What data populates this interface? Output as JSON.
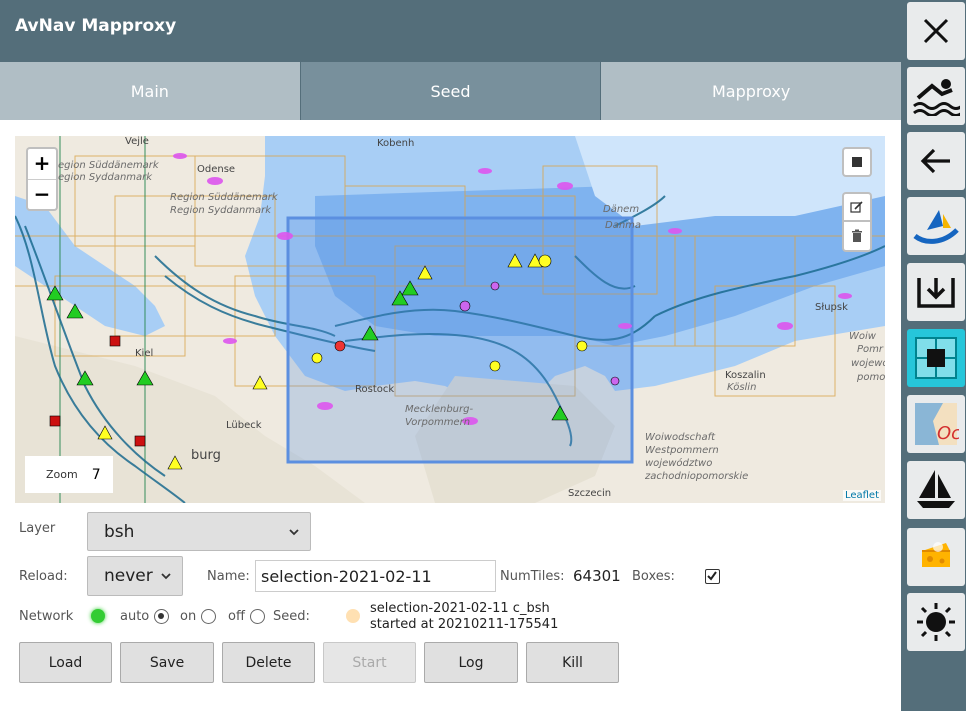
{
  "app": {
    "title": "AvNav Mapproxy"
  },
  "tabs": [
    {
      "label": "Main",
      "active": false
    },
    {
      "label": "Seed",
      "active": true
    },
    {
      "label": "Mapproxy",
      "active": false
    }
  ],
  "sidebar": {
    "buttons": [
      {
        "name": "close-icon",
        "active": false
      },
      {
        "name": "man-overboard-icon",
        "active": false
      },
      {
        "name": "back-arrow-icon",
        "active": false
      },
      {
        "name": "avnav-logo-icon",
        "active": false
      },
      {
        "name": "download-icon",
        "active": false
      },
      {
        "name": "mapproxy-icon",
        "active": true
      },
      {
        "name": "ocharts-icon",
        "active": false
      },
      {
        "name": "sailboat-icon",
        "active": false
      },
      {
        "name": "cheese-icon",
        "active": false
      },
      {
        "name": "brightness-icon",
        "active": false
      }
    ]
  },
  "map": {
    "zoom_in": "+",
    "zoom_out": "−",
    "zoom_label": "Zoom",
    "zoom_value": "7",
    "attribution": "Leaflet",
    "labels": {
      "koben": "Kobenh",
      "odense": "Odense",
      "sudd1": "Region Süddänemark",
      "sudd2": "Region Syddanmark",
      "sudd3": "Region Süddänemark",
      "sudd4": "Region Syddanmark",
      "vejle": "Vejle",
      "danem": "Dänem",
      "danma": "Danma",
      "rostock": "Rostock",
      "meck1": "Mecklenburg-",
      "meck2": "Vorpommern",
      "lubeck": "Lübeck",
      "hamburg": "burg",
      "kiel": "Kiel",
      "koszalin1": "Koszalin",
      "koszalin2": "Köslin",
      "slupsk": "Słupsk",
      "woj1": "Woiwodschaft",
      "woj2": "Westpommern",
      "woj3": "województwo",
      "woj4": "zachodniopomorskie",
      "szczecin": "Szczecin",
      "pom1": "Woiw",
      "pom2": "Pomr",
      "pom3": "wojewó",
      "pom4": "pomo"
    }
  },
  "form": {
    "layer_label": "Layer",
    "layer_value": "bsh",
    "reload_label": "Reload:",
    "reload_value": "never",
    "name_label": "Name:",
    "name_value": "selection-2021-02-11",
    "numtiles_label": "NumTiles:",
    "numtiles_value": "64301",
    "boxes_label": "Boxes:",
    "boxes_checked": true,
    "network_label": "Network",
    "network_status_color": "#33cc33",
    "radio_auto": "auto",
    "radio_on": "on",
    "radio_off": "off",
    "network_mode": "auto",
    "seed_label": "Seed:",
    "seed_status_color": "#ffe0b2",
    "seed_line1": "selection-2021-02-11 c_bsh",
    "seed_line2": "started at 20210211-175541"
  },
  "buttons": {
    "load": "Load",
    "save": "Save",
    "delete": "Delete",
    "start": "Start",
    "log": "Log",
    "kill": "Kill"
  },
  "colors": {
    "header": "#546e7a",
    "tab": "#b0bec5",
    "tab_active": "#78909c",
    "accent": "#26c6da",
    "sea": "#a3cdfa",
    "selection": "#5b8fe0"
  }
}
